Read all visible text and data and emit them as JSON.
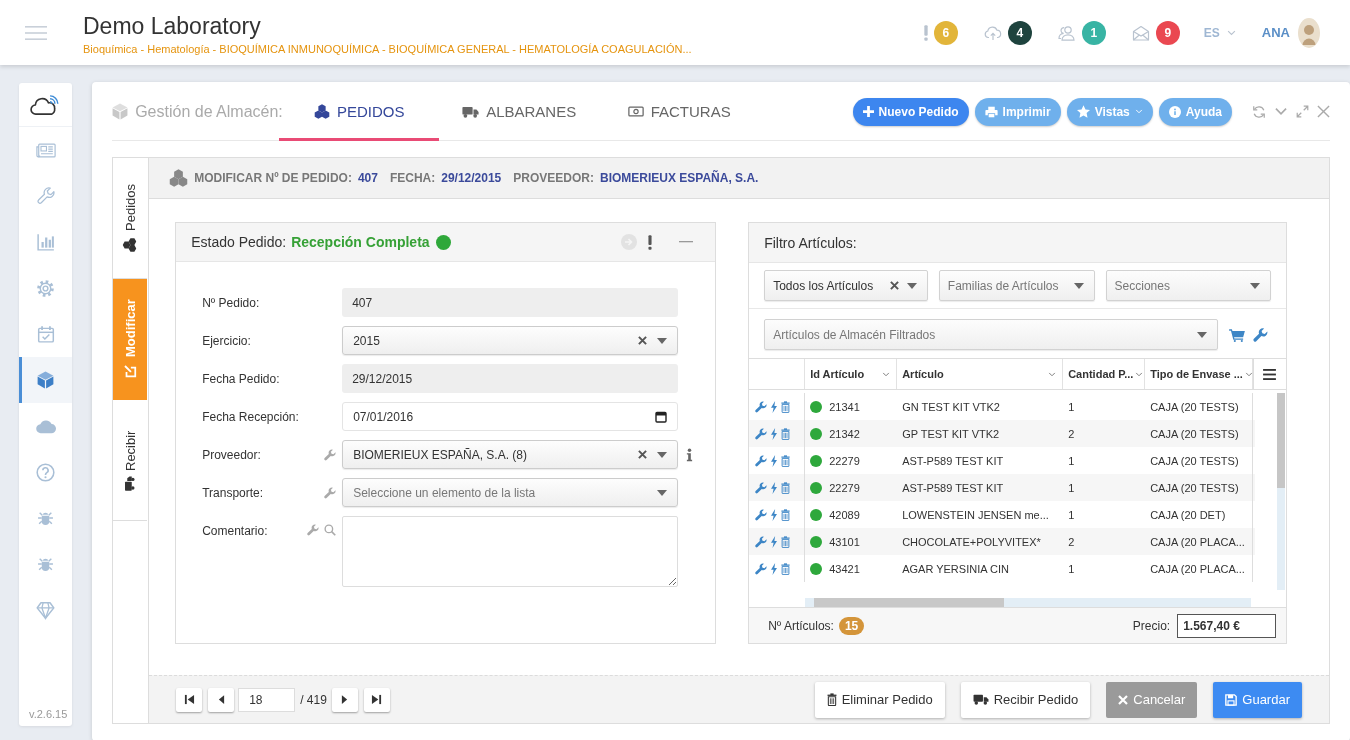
{
  "header": {
    "title": "Demo Laboratory",
    "subtitle": "Bioquímica - Hematología - BIOQUÍMICA INMUNOQUÍMICA - BIOQUÍMICA GENERAL - HEMATOLOGÍA COAGULACIÓN...",
    "notifications": [
      {
        "kind": "alert",
        "count": "6",
        "color": "#e2b53a"
      },
      {
        "kind": "upload",
        "count": "4",
        "color": "#1e433e"
      },
      {
        "kind": "users",
        "count": "1",
        "color": "#38b4a4"
      },
      {
        "kind": "mail",
        "count": "9",
        "color": "#ea4851"
      }
    ],
    "language": "ES",
    "user": "ANA"
  },
  "sidebar": {
    "items": [
      {
        "kind": "news",
        "selected": false
      },
      {
        "kind": "wrench",
        "selected": false
      },
      {
        "kind": "chart",
        "selected": false
      },
      {
        "kind": "gear",
        "selected": false
      },
      {
        "kind": "calendar",
        "selected": false
      },
      {
        "kind": "cube",
        "selected": true
      },
      {
        "kind": "cloud",
        "selected": false
      },
      {
        "kind": "help",
        "selected": false
      },
      {
        "kind": "bug",
        "selected": false
      },
      {
        "kind": "bug",
        "selected": false
      },
      {
        "kind": "diamond",
        "selected": false
      }
    ],
    "version": "v.2.6.15"
  },
  "module": {
    "title": "Gestión de Almacén:",
    "tabs": [
      {
        "kind": "cubes",
        "label": "PEDIDOS",
        "selected": true
      },
      {
        "kind": "truck",
        "label": "ALBARANES",
        "selected": false
      },
      {
        "kind": "money",
        "label": "FACTURAS",
        "selected": false
      }
    ],
    "actions": [
      {
        "kind": "plus",
        "label": "Nuevo Pedido",
        "primary": true,
        "dropdown": false
      },
      {
        "kind": "print",
        "label": "Imprimir",
        "primary": false,
        "dropdown": false
      },
      {
        "kind": "star",
        "label": "Vistas",
        "primary": false,
        "dropdown": true
      },
      {
        "kind": "info",
        "label": "Ayuda",
        "primary": false,
        "dropdown": false
      }
    ]
  },
  "side_tabs": [
    {
      "kind": "cubes",
      "label": "Pedidos",
      "selected": false
    },
    {
      "kind": "edit",
      "label": "Modificar",
      "selected": true
    },
    {
      "kind": "truck",
      "label": "Recibir",
      "selected": false
    }
  ],
  "order_header": [
    {
      "label": "MODIFICAR Nº DE PEDIDO:",
      "value": "407"
    },
    {
      "label": "FECHA:",
      "value": "29/12/2015"
    },
    {
      "label": "PROVEEDOR:",
      "value": "BIOMERIEUX ESPAÑA, S.A."
    }
  ],
  "status_panel": {
    "title": "Estado Pedido:",
    "status": "Recepción Completa",
    "fields": [
      {
        "kind": "readonly",
        "label": "Nº Pedido:",
        "value": "407",
        "edit_tool": false,
        "search_tool": false,
        "info": false
      },
      {
        "kind": "select",
        "label": "Ejercicio:",
        "value": "2015",
        "clearable": true,
        "edit_tool": false,
        "search_tool": false,
        "info": false
      },
      {
        "kind": "readonly",
        "label": "Fecha Pedido:",
        "value": "29/12/2015",
        "edit_tool": false,
        "search_tool": false,
        "info": false
      },
      {
        "kind": "date",
        "label": "Fecha Recepción:",
        "value": "07/01/2016",
        "edit_tool": false,
        "search_tool": false,
        "info": false
      },
      {
        "kind": "select",
        "label": "Proveedor:",
        "value": "BIOMERIEUX ESPAÑA, S.A. (8)",
        "clearable": true,
        "edit_tool": true,
        "search_tool": false,
        "info": true
      },
      {
        "kind": "select",
        "label": "Transporte:",
        "placeholder": "Seleccione un elemento de la lista",
        "clearable": false,
        "edit_tool": true,
        "search_tool": false,
        "info": false
      },
      {
        "kind": "textarea",
        "label": "Comentario:",
        "edit_tool": true,
        "search_tool": true,
        "info": false
      }
    ]
  },
  "filter_panel": {
    "title": "Filtro Artículos:",
    "filters": [
      {
        "value": "Todos los Artículos",
        "clearable": true
      },
      {
        "placeholder": "Familias de Artículos",
        "clearable": false
      },
      {
        "placeholder": "Secciones",
        "clearable": false
      }
    ],
    "article_select": {
      "placeholder": "Artículos de Almacén Filtrados"
    },
    "table": {
      "columns": [
        {
          "label": "Id Artículo"
        },
        {
          "label": "Artículo"
        },
        {
          "label": "Cantidad P..."
        },
        {
          "label": "Tipo de Envase ..."
        }
      ],
      "rows": [
        {
          "id": "21341",
          "article": "GN TEST KIT VTK2",
          "quantity": "1",
          "package": "CAJA (20 TESTS)"
        },
        {
          "id": "21342",
          "article": "GP TEST KIT VTK2",
          "quantity": "2",
          "package": "CAJA (20 TESTS)"
        },
        {
          "id": "22279",
          "article": "AST-P589 TEST KIT",
          "quantity": "1",
          "package": "CAJA (20 TESTS)"
        },
        {
          "id": "22279",
          "article": "AST-P589 TEST KIT",
          "quantity": "1",
          "package": "CAJA (20 TESTS)"
        },
        {
          "id": "42089",
          "article": "LOWENSTEIN JENSEN me...",
          "quantity": "1",
          "package": "CAJA (20 DET)"
        },
        {
          "id": "43101",
          "article": "CHOCOLATE+POLYVITEX*",
          "quantity": "2",
          "package": "CAJA (20 PLACA..."
        },
        {
          "id": "43421",
          "article": "AGAR YERSINIA CIN",
          "quantity": "1",
          "package": "CAJA (20 PLACA..."
        }
      ]
    },
    "count_label": "Nº Artículos:",
    "count": "15",
    "price_label": "Precio:",
    "price": "1.567,40 €"
  },
  "pager": {
    "page": "18",
    "total": "/ 419"
  },
  "buttons": [
    {
      "kind": "trash",
      "label": "Eliminar Pedido",
      "disabled": false,
      "primary": false
    },
    {
      "kind": "truck",
      "label": "Recibir Pedido",
      "disabled": false,
      "primary": false
    },
    {
      "kind": "cancel",
      "label": "Cancelar",
      "disabled": true,
      "primary": false
    },
    {
      "kind": "save",
      "label": "Guardar",
      "disabled": false,
      "primary": true
    }
  ]
}
